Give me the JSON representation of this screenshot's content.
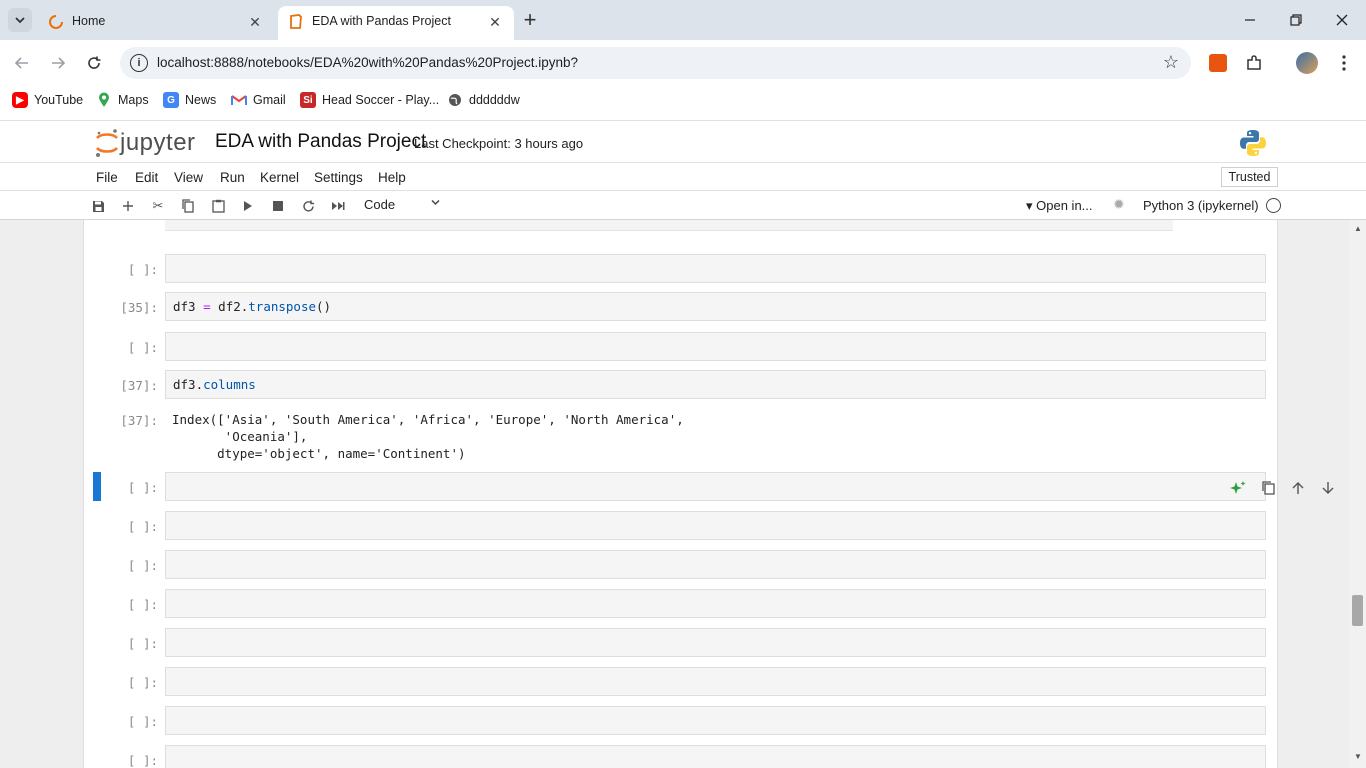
{
  "browser": {
    "tabs": [
      {
        "title": "Home",
        "icon": "jupyter-loading-icon",
        "active": false
      },
      {
        "title": "EDA with Pandas Project",
        "icon": "notebook-icon",
        "active": true
      }
    ],
    "url": "localhost:8888/notebooks/EDA%20with%20Pandas%20Project.ipynb?",
    "bookmarks": [
      {
        "label": "YouTube",
        "icon": "youtube-icon"
      },
      {
        "label": "Maps",
        "icon": "maps-icon"
      },
      {
        "label": "News",
        "icon": "news-icon"
      },
      {
        "label": "Gmail",
        "icon": "gmail-icon"
      },
      {
        "label": "Head Soccer - Play...",
        "icon": "head-soccer-icon"
      },
      {
        "label": "ddddddw",
        "icon": "globe-icon"
      }
    ]
  },
  "jupyter": {
    "logo_text": "jupyter",
    "notebook_title": "EDA with Pandas Project",
    "checkpoint": "Last Checkpoint: 3 hours ago",
    "menu": [
      "File",
      "Edit",
      "View",
      "Run",
      "Kernel",
      "Settings",
      "Help"
    ],
    "trusted": "Trusted",
    "cell_type": "Code",
    "open_in": "Open in...",
    "kernel": "Python 3 (ipykernel)"
  },
  "cells": {
    "c1_prompt": "[ ]:",
    "c2_prompt": "[35]:",
    "c2_code_a": "df3 ",
    "c2_code_op": "=",
    "c2_code_b": " df2.",
    "c2_code_attr": "transpose",
    "c2_code_c": "()",
    "c3_prompt": "[ ]:",
    "c4_prompt": "[37]:",
    "c4_code_a": "df3.",
    "c4_code_attr": "columns",
    "c4_out_prompt": "[37]:",
    "c4_out_line1": "Index(['Asia', 'South America', 'Africa', 'Europe', 'North America',",
    "c4_out_line2": "       'Oceania'],",
    "c4_out_line3": "      dtype='object', name='Continent')",
    "active_prompt": "[ ]:",
    "empty_prompt": "[ ]:"
  },
  "colors": {
    "accent": "#1976d2",
    "jupyter_orange": "#f37726"
  }
}
